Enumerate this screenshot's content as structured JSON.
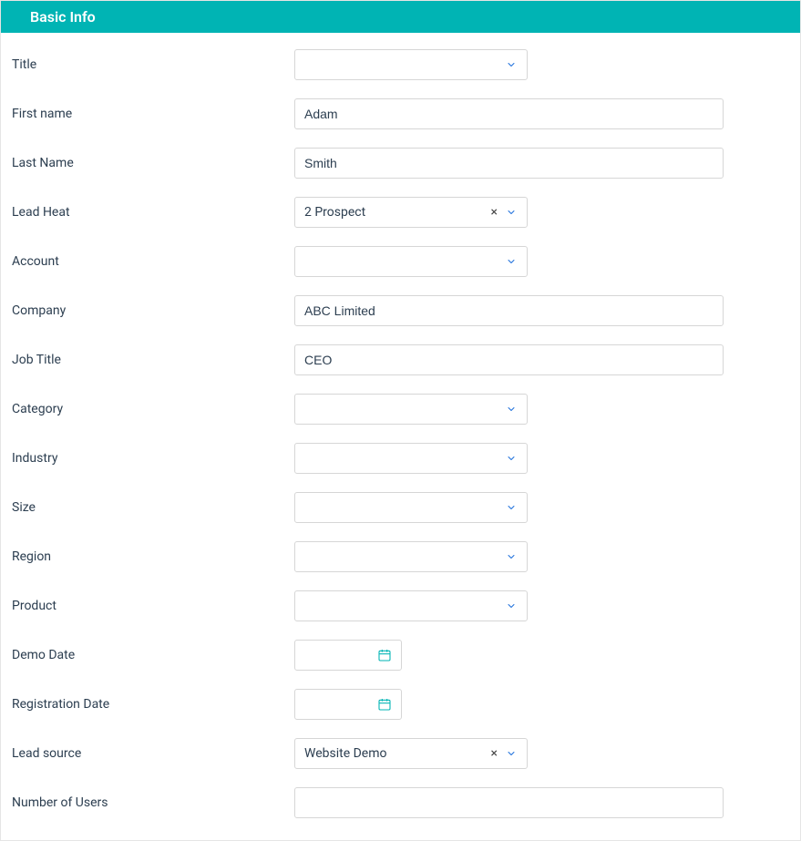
{
  "panel": {
    "title": "Basic Info"
  },
  "fields": {
    "title": {
      "label": "Title",
      "value": ""
    },
    "first_name": {
      "label": "First name",
      "value": "Adam"
    },
    "last_name": {
      "label": "Last Name",
      "value": "Smith"
    },
    "lead_heat": {
      "label": "Lead Heat",
      "value": "2 Prospect"
    },
    "account": {
      "label": "Account",
      "value": ""
    },
    "company": {
      "label": "Company",
      "value": "ABC Limited"
    },
    "job_title": {
      "label": "Job Title",
      "value": "CEO"
    },
    "category": {
      "label": "Category",
      "value": ""
    },
    "industry": {
      "label": "Industry",
      "value": ""
    },
    "size": {
      "label": "Size",
      "value": ""
    },
    "region": {
      "label": "Region",
      "value": ""
    },
    "product": {
      "label": "Product",
      "value": ""
    },
    "demo_date": {
      "label": "Demo Date",
      "value": ""
    },
    "reg_date": {
      "label": "Registration Date",
      "value": ""
    },
    "lead_source": {
      "label": "Lead source",
      "value": "Website Demo"
    },
    "num_users": {
      "label": "Number of Users",
      "value": ""
    }
  },
  "icons": {
    "clear": "×"
  }
}
